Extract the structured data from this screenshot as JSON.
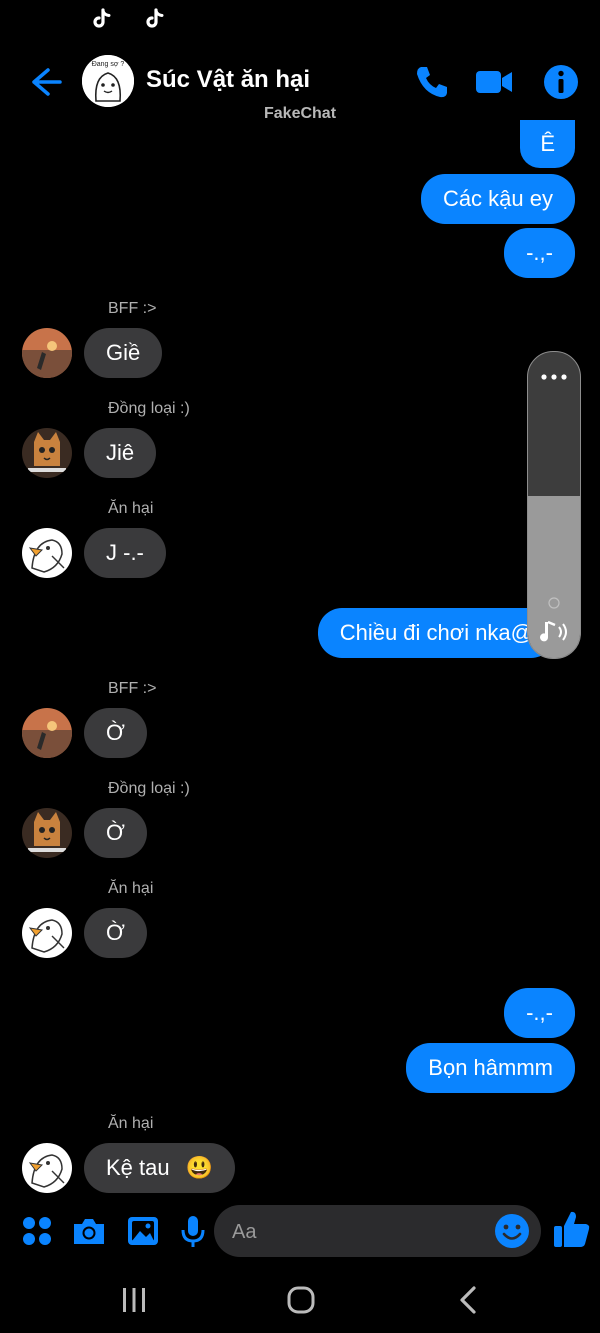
{
  "status_bar": {
    "icons": [
      "tiktok-icon",
      "tiktok-icon"
    ]
  },
  "header": {
    "title": "Súc Vật ăn hại",
    "watermark": "FakeChat",
    "avatar_caption": "Đang sợ ?",
    "icons": [
      "back-arrow-icon",
      "phone-icon",
      "video-camera-icon",
      "info-icon"
    ]
  },
  "colors": {
    "accent": "#0a84ff",
    "incoming_bubble": "#3a3a3c",
    "background": "#000000"
  },
  "messages": {
    "out_1": "Ê",
    "out_2": "Các kậu ey",
    "out_3": "-.,-",
    "sender_1": "BFF :>",
    "in_1": "Giề",
    "sender_2": "Đồng loại :)",
    "in_2": "Jiê",
    "sender_3": "Ăn hại",
    "in_3": "J -.-",
    "out_4": "Chiều đi chơi nka@",
    "sender_4": "BFF :>",
    "in_4": "Ờ",
    "sender_5": "Đồng loại :)",
    "in_5": "Ờ",
    "sender_6": "Ăn hại",
    "in_6": "Ờ",
    "out_5": "-.,-",
    "out_6": "Bọn hâmmm",
    "sender_7": "Ăn hại",
    "in_7": "Kệ tau",
    "in_7_emoji": "😃"
  },
  "volume_overlay": {
    "level": 0.53,
    "icons": [
      "more-options-icon",
      "music-note-icon"
    ]
  },
  "composer": {
    "placeholder": "Aa",
    "icons": [
      "apps-icon",
      "camera-icon",
      "gallery-icon",
      "microphone-icon",
      "emoji-icon",
      "thumbs-up-icon"
    ]
  },
  "nav_bar": {
    "icons": [
      "recent-apps-icon",
      "home-icon",
      "back-icon"
    ]
  }
}
